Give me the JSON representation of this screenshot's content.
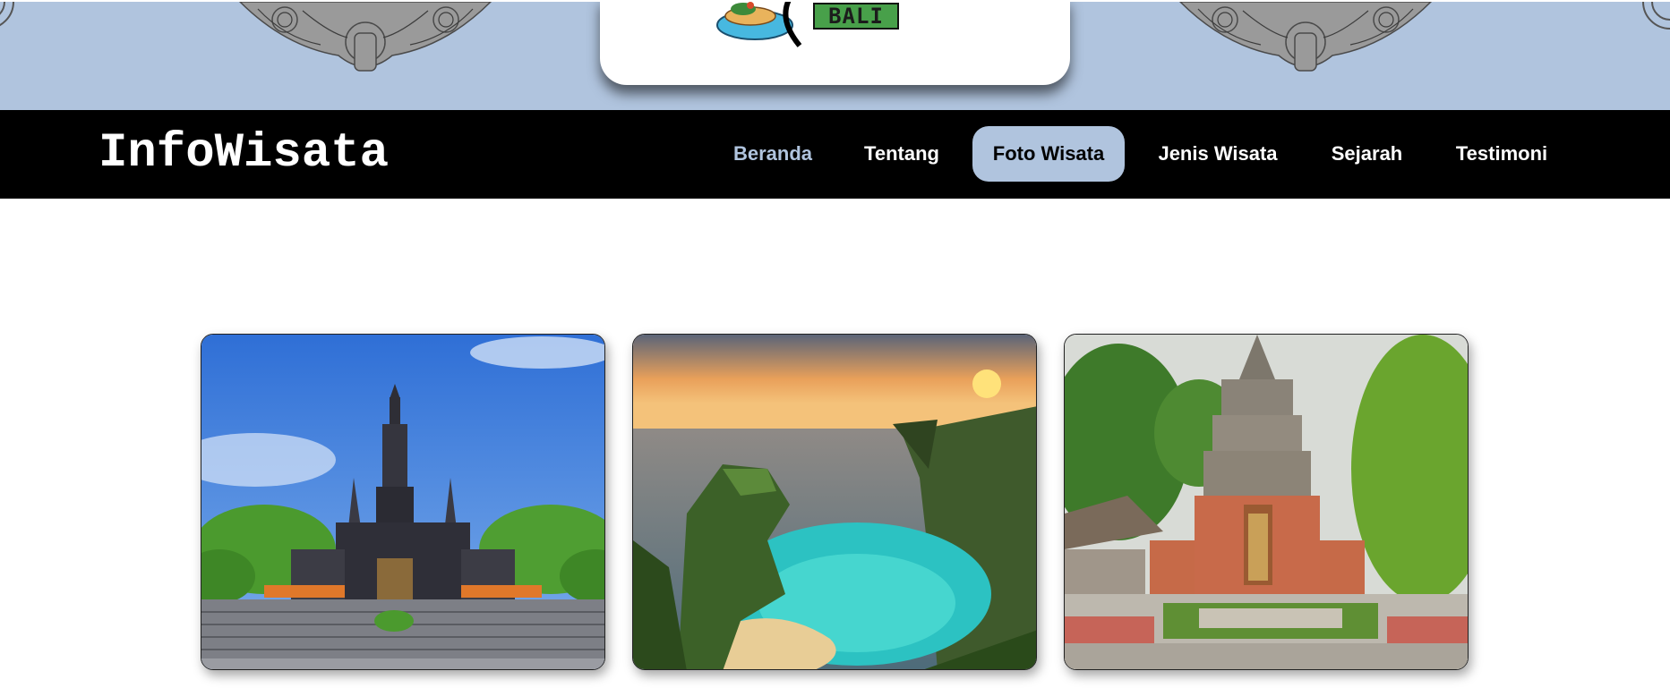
{
  "banner": {
    "logo_text": "BALI",
    "ornament_icon": "balinese-ornament-icon",
    "logo_icon": "island-logo-icon",
    "colors": {
      "banner_bg": "#b0c4de",
      "logo_text_bg": "#48a04a"
    }
  },
  "navbar": {
    "brand": "InfoWisata",
    "links": [
      {
        "label": "Beranda",
        "state": "home"
      },
      {
        "label": "Tentang",
        "state": "normal"
      },
      {
        "label": "Foto Wisata",
        "state": "active"
      },
      {
        "label": "Jenis Wisata",
        "state": "normal"
      },
      {
        "label": "Sejarah",
        "state": "normal"
      },
      {
        "label": "Testimoni",
        "state": "normal"
      }
    ],
    "colors": {
      "bg": "#000000",
      "active_bg": "#b0c4de",
      "home_text": "#b0c4de"
    }
  },
  "gallery": {
    "photos": [
      {
        "subject": "monument-photo"
      },
      {
        "subject": "coastal-cliff-photo"
      },
      {
        "subject": "temple-gate-photo"
      }
    ]
  }
}
